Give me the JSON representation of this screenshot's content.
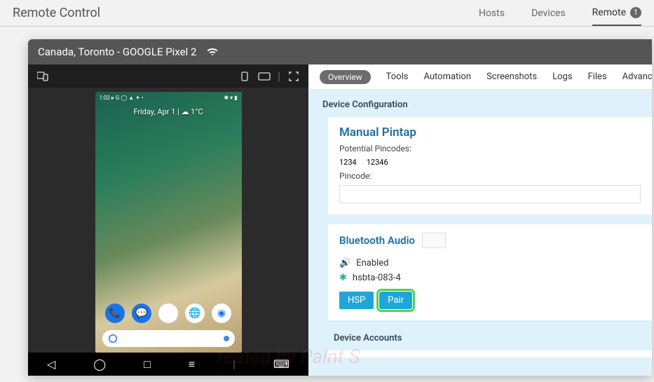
{
  "header": {
    "title": "Remote Control",
    "nav": {
      "hosts": "Hosts",
      "devices": "Devices",
      "remote": "Remote",
      "remote_badge": "1"
    }
  },
  "window": {
    "title": "Canada, Toronto - GOOGLE Pixel 2"
  },
  "phone": {
    "status_left": "1:02 ▸ G ◯ ▲ ✦ •",
    "status_right": "✱ ▾ ▮",
    "date": "Friday, Apr 1 | ☁ 1°C",
    "nav": {
      "back": "◁",
      "home": "◯",
      "recent": "□",
      "menu": "≡",
      "keyboard": "⌨"
    }
  },
  "tabs": {
    "overview": "Overview",
    "tools": "Tools",
    "automation": "Automation",
    "screenshots": "Screenshots",
    "logs": "Logs",
    "files": "Files",
    "advanced": "Advanced"
  },
  "panel": {
    "section": "Device Configuration",
    "manual": {
      "title": "Manual Pintap",
      "potential_label": "Potential Pincodes:",
      "codes": [
        "1234",
        "12346"
      ],
      "pincode_label": "Pincode:"
    },
    "bt": {
      "title": "Bluetooth Audio",
      "enabled": "Enabled",
      "device": "hsbta-083-4",
      "hsp": "HSP",
      "pair": "Pair"
    },
    "accounts": "Device Accounts"
  },
  "watermark": "reated by Paint S"
}
